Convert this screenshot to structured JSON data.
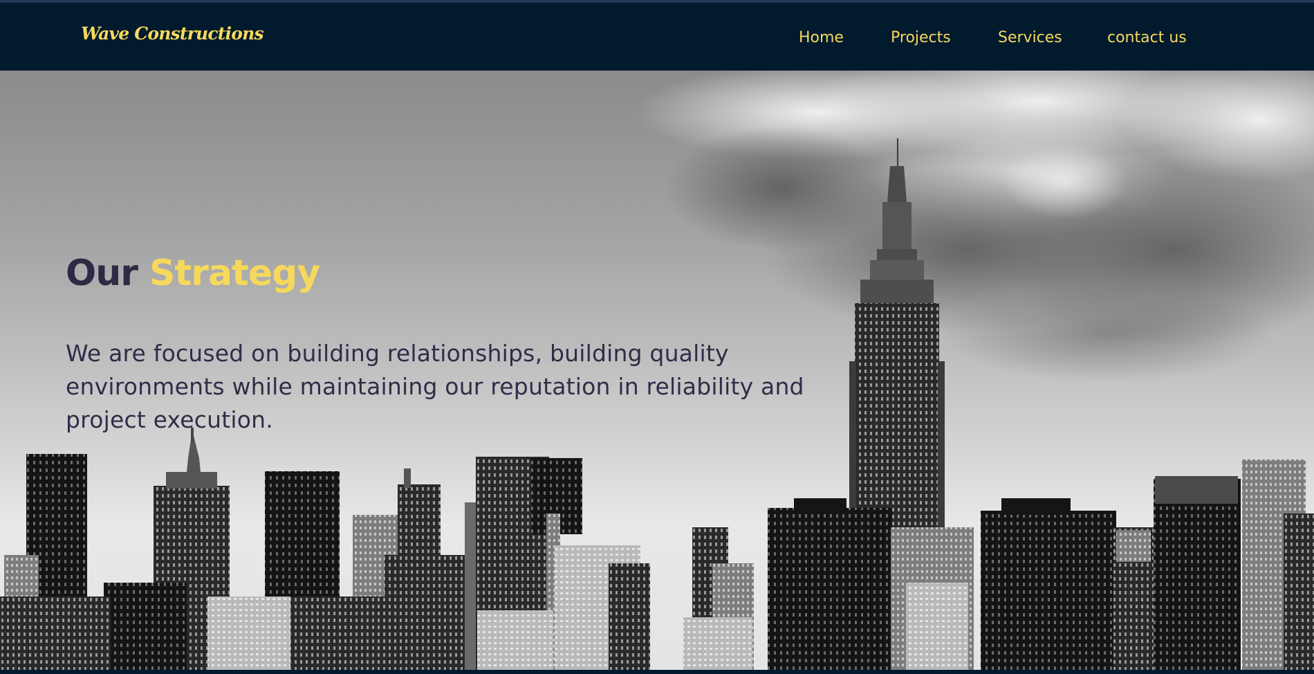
{
  "brand": {
    "logo_text": "Wave Constructions"
  },
  "nav": {
    "items": [
      {
        "label": "Home"
      },
      {
        "label": "Projects"
      },
      {
        "label": "Services"
      },
      {
        "label": "contact us"
      }
    ]
  },
  "hero": {
    "title_part1": "Our",
    "title_part2": "Strategy",
    "description": "We are focused on building relationships, building quality environments while maintaining our reputation in reliability and project execution.",
    "background_image": "black-and-white city skyline"
  },
  "colors": {
    "navbar_bg": "#021a2e",
    "accent_yellow": "#f6d95c",
    "heading_dark": "#2c2a44",
    "body_text": "#2f2d48"
  }
}
